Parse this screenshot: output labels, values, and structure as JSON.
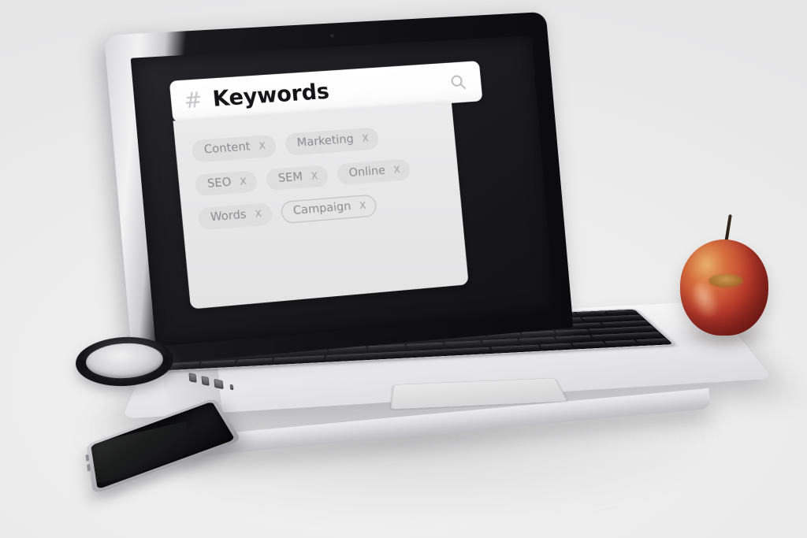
{
  "scene": {
    "background_color": "#ececed",
    "description": "laptop-on-desk-photo"
  },
  "app": {
    "search_bar": {
      "hash_symbol": "#",
      "title": "Keywords",
      "search_icon": "search-icon"
    },
    "tag_rows": [
      [
        {
          "label": "Content",
          "remove": "X",
          "style": "filled"
        },
        {
          "label": "Marketing",
          "remove": "X",
          "style": "filled"
        }
      ],
      [
        {
          "label": "SEO",
          "remove": "X",
          "style": "filled"
        },
        {
          "label": "SEM",
          "remove": "X",
          "style": "filled"
        },
        {
          "label": "Online",
          "remove": "X",
          "style": "filled"
        }
      ],
      [
        {
          "label": "Words",
          "remove": "X",
          "style": "filled"
        },
        {
          "label": "Campaign",
          "remove": "X",
          "style": "outlined"
        }
      ]
    ],
    "colors": {
      "header_background": "#ffffff",
      "header_text": "#141416",
      "hash_color": "#c6c6c8",
      "panel_background": "#e7e7e8",
      "tag_background": "#dededf",
      "tag_text": "#8c8c8f",
      "tag_outline": "#bdbdbf"
    }
  },
  "desk_objects": {
    "laptop": {
      "name": "laptop",
      "body_color": "#e7e7e9",
      "keyboard_color": "#111113"
    },
    "lens_cap": {
      "name": "camera-lens-cap",
      "text": ""
    },
    "phone": {
      "name": "smartphone",
      "screen_state": "off"
    },
    "apple": {
      "name": "red-apple",
      "color": "#bb3b2c"
    }
  }
}
